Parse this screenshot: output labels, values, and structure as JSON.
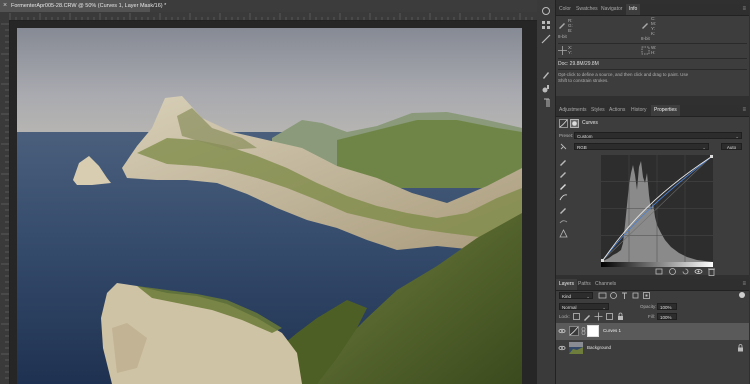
{
  "document_tab": {
    "title": "FormenterApr005-28.CRW @ 50% (Curves 1, Layer Mask/16) *",
    "close": "×"
  },
  "info_panel": {
    "tabs": [
      "Color",
      "Swatches",
      "Navigator",
      "Info"
    ],
    "active_tab": "Info",
    "menu": "≡",
    "readouts": {
      "c_label": "C:",
      "m_label": "M:",
      "y_label": "Y:",
      "k_label": "K:",
      "r_label": "R:",
      "g_label": "G:",
      "b_label": "B:",
      "x_label": "X:",
      "y2_label": "Y:",
      "w_label": "W:",
      "h_label": "H:",
      "bit_depth": "8-bit"
    },
    "doc_size": "Doc: 29.8M/29.8M",
    "hint": "Opt-click to define a source, and then click and drag to paint. Use Shift to constrain strokes."
  },
  "properties_panel": {
    "tabs": [
      "Adjustments",
      "Styles",
      "Actions",
      "History",
      "Properties"
    ],
    "active_tab": "Properties",
    "menu": "≡",
    "title": "Curves",
    "preset_label": "Preset:",
    "preset_value": "Custom",
    "channel_value": "RGB",
    "auto_button": "Auto"
  },
  "layers_panel": {
    "tabs": [
      "Layers",
      "Paths",
      "Channels"
    ],
    "active_tab": "Layers",
    "menu": "≡",
    "filter_value": "Kind",
    "blend_mode": "Normal",
    "opacity_label": "Opacity:",
    "opacity_value": "100%",
    "lock_label": "Lock:",
    "fill_label": "Fill:",
    "fill_value": "100%",
    "layers": [
      {
        "name": "Curves 1",
        "selected": true
      },
      {
        "name": "Background",
        "selected": false
      }
    ]
  },
  "colors": {
    "panel_bg": "#3d3d3d",
    "selected_layer": "#5a5a5a",
    "accent": "#2f7bd6"
  }
}
